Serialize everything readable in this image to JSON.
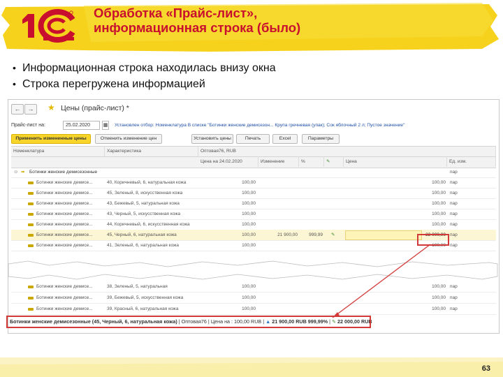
{
  "slide": {
    "title_line1": "Обработка «Прайс-лист»,",
    "title_line2": "информационная строка (было)",
    "bullets": [
      "Информационная строка находилась внизу окна",
      "Строка перегружена информацией"
    ],
    "page_number": "63",
    "logo_text": "1С",
    "accent_color": "#c8102e",
    "brush_color": "#f6d21c"
  },
  "window": {
    "title": "Цены (прайс-лист) *",
    "back_icon": "arrow-left-icon",
    "forward_icon": "arrow-right-icon",
    "favorite_icon": "star-icon",
    "date_label": "Прайс-лист на:",
    "date_value": "25.02.2020",
    "filter_text": "Установлен отбор: Номенклатура В списке \"Ботинки женские демисезон... Крупа гречневая (упак); Сок яблочный 2 л; Пустое значение\"",
    "toolbar": {
      "apply": "Применить измененные цены",
      "cancel": "Отменить изменение цен",
      "set_prices": "Установить цены",
      "print": "Печать",
      "excel": "Excel",
      "params": "Параметры"
    },
    "columns": {
      "nomenclature": "Номенклатура",
      "characteristic": "Характеристика",
      "price_type": "Оптовая76, RUB",
      "price_on_date": "Цена на 24.02.2020",
      "change": "Изменение",
      "percent": "%",
      "price": "Цена",
      "unit": "Ед. изм."
    },
    "group_row": {
      "name": "Ботинки женские демисезонные",
      "unit": "пар"
    },
    "rows_top": [
      {
        "name": "Ботинки женские демисе...",
        "char": "40, Коричневый, 6, натуральная кожа",
        "old": "100,00",
        "price": "100,00",
        "unit": "пар"
      },
      {
        "name": "Ботинки женские демисе...",
        "char": "45, Зеленый, 8, искусственная кожа",
        "old": "100,00",
        "price": "100,00",
        "unit": "пар"
      },
      {
        "name": "Ботинки женские демисе...",
        "char": "43, Бежевый, 5, натуральная кожа",
        "old": "100,00",
        "price": "100,00",
        "unit": "пар"
      },
      {
        "name": "Ботинки женские демисе...",
        "char": "43, Черный, 5, искусственная кожа",
        "old": "100,00",
        "price": "100,00",
        "unit": "пар"
      },
      {
        "name": "Ботинки женские демисе...",
        "char": "44, Коричневый, 6, искусственная кожа",
        "old": "100,00",
        "price": "100,00",
        "unit": "пар"
      }
    ],
    "selected_row": {
      "name": "Ботинки женские демисе...",
      "char": "45, Черный, 6, натуральная кожа",
      "old": "100,00",
      "change": "21 900,00",
      "percent": "999,99",
      "price": "22 000,00",
      "unit": "пар"
    },
    "rows_after": [
      {
        "name": "Ботинки женские демисе...",
        "char": "41, Зеленый, 6, натуральная кожа",
        "old": "100,00",
        "price": "100,00",
        "unit": "пар"
      }
    ],
    "rows_bottom": [
      {
        "name": "Ботинки женские демисе...",
        "char": "38, Зеленый, 5, натуральная",
        "old": "100,00",
        "price": "100,00",
        "unit": "пар"
      },
      {
        "name": "Ботинки женские демисе...",
        "char": "39, Бежевый, 5, искусственная кожа",
        "old": "100,00",
        "price": "100,00",
        "unit": "пар"
      },
      {
        "name": "Ботинки женские демисе...",
        "char": "39, Красный, 6, натуральная кожа",
        "old": "100,00",
        "price": "100,00",
        "unit": "пар"
      }
    ],
    "status": {
      "item": "Ботинки женские демисезонные (45, Черный, 6, натуральная кожа)",
      "price_type": "Оптовая76",
      "old_price": "Цена на : 100,00 RUB",
      "change": "21 900,00 RUB 999,99%",
      "new_price": "22 000,00 RUB"
    }
  }
}
